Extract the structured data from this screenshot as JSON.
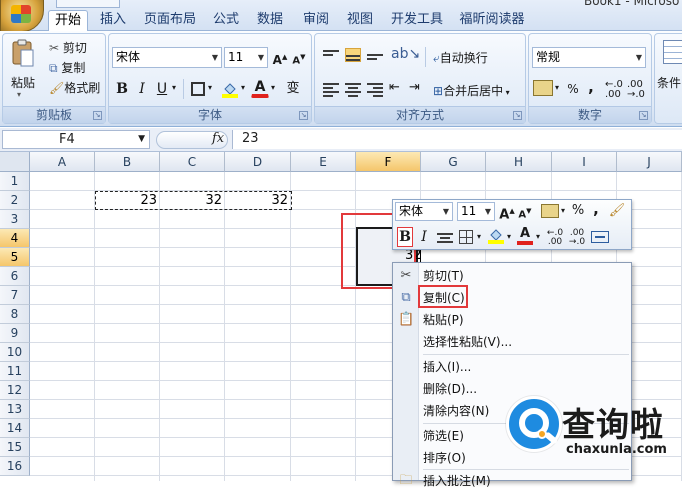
{
  "window": {
    "title_tail": "Book1 - Microso"
  },
  "tabs": [
    "开始",
    "插入",
    "页面布局",
    "公式",
    "数据",
    "审阅",
    "视图",
    "开发工具",
    "福昕阅读器"
  ],
  "clipboard": {
    "paste": "粘贴",
    "cut": "剪切",
    "copy": "复制",
    "format_painter": "格式刷",
    "group": "剪贴板"
  },
  "font": {
    "name": "宋体",
    "size": "11",
    "bold": "B",
    "italic": "I",
    "underline": "U",
    "phonetic": "变",
    "group": "字体"
  },
  "alignment": {
    "wrap": "自动换行",
    "merge": "合并后居中",
    "group": "对齐方式"
  },
  "number": {
    "format": "常规",
    "percent": "%",
    "comma": ",",
    "group": "数字"
  },
  "styles": {
    "conditional": "条件"
  },
  "formula_bar": {
    "name_box": "F4",
    "fx": "fx",
    "content": "23"
  },
  "columns": [
    "A",
    "B",
    "C",
    "D",
    "E",
    "F",
    "G",
    "H",
    "I",
    "J"
  ],
  "rows": [
    "1",
    "2",
    "3",
    "4",
    "5",
    "6",
    "7",
    "8",
    "9",
    "10",
    "11",
    "12",
    "13",
    "14",
    "15",
    "16"
  ],
  "cells": {
    "B2": "23",
    "C2": "32",
    "D2": "32"
  },
  "edit_value": "32",
  "mini_toolbar": {
    "font": "宋体",
    "size": "11",
    "percent": "%",
    "comma": ",",
    "bold": "B",
    "italic": "I",
    "font_color_letter": "A"
  },
  "context_menu": [
    {
      "label": "剪切(T)",
      "icon": "scissors-icon"
    },
    {
      "label": "复制(C)",
      "icon": "copy-icon"
    },
    {
      "label": "粘贴(P)",
      "icon": "paste-icon"
    },
    {
      "label": "选择性粘贴(V)...",
      "icon": ""
    },
    {
      "label": "插入(I)...",
      "icon": ""
    },
    {
      "label": "删除(D)...",
      "icon": ""
    },
    {
      "label": "清除内容(N)",
      "icon": ""
    },
    {
      "label": "筛选(E)",
      "icon": ""
    },
    {
      "label": "排序(O)",
      "icon": ""
    },
    {
      "label": "插入批注(M)",
      "icon": "comment-icon"
    }
  ],
  "watermark": {
    "cn": "查询啦",
    "en": "chaxunla.com"
  },
  "colors": {
    "highlight_red": "#e2393b",
    "header_selected": "#f5c66b",
    "ribbon_blue": "#dfe9f6"
  }
}
